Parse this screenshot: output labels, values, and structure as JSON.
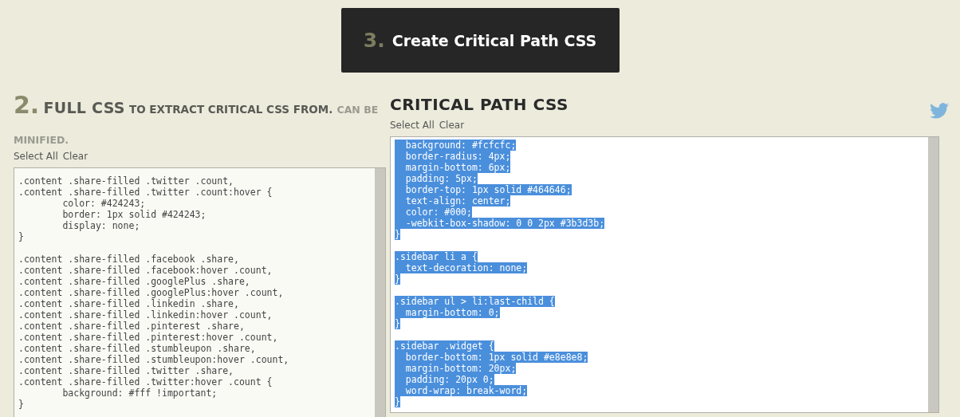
{
  "create_button": {
    "number": "3.",
    "label": "Create Critical Path CSS"
  },
  "full_css": {
    "number": "2.",
    "title": "FULL CSS",
    "subtitle": "TO EXTRACT CRITICAL CSS FROM.",
    "note": "CAN BE MINIFIED.",
    "actions": [
      "Select All",
      "Clear"
    ],
    "blocks": [
      {
        "selected": false,
        "lines": [
          ".content .share-filled .twitter .count,",
          ".content .share-filled .twitter .count:hover {",
          "        color: #424243;",
          "        border: 1px solid #424243;",
          "        display: none;",
          "}"
        ]
      },
      {
        "selected": false,
        "lines": [
          ".content .share-filled .facebook .share,",
          ".content .share-filled .facebook:hover .count,",
          ".content .share-filled .googlePlus .share,",
          ".content .share-filled .googlePlus:hover .count,",
          ".content .share-filled .linkedin .share,",
          ".content .share-filled .linkedin:hover .count,",
          ".content .share-filled .pinterest .share,",
          ".content .share-filled .pinterest:hover .count,",
          ".content .share-filled .stumbleupon .share,",
          ".content .share-filled .stumbleupon:hover .count,",
          ".content .share-filled .twitter .share,",
          ".content .share-filled .twitter:hover .count {",
          "        background: #fff !important;",
          "}"
        ]
      }
    ]
  },
  "critical_css": {
    "title": "CRITICAL PATH CSS",
    "actions": [
      "Select All",
      "Clear"
    ],
    "blocks": [
      {
        "selected": true,
        "lines": [
          "  background: #fcfcfc;",
          "  border-radius: 4px;",
          "  margin-bottom: 6px;",
          "  padding: 5px;",
          "  border-top: 1px solid #464646;",
          "  text-align: center;",
          "  color: #000;",
          "  -webkit-box-shadow: 0 0 2px #3b3d3b;",
          "}"
        ]
      },
      {
        "selected": true,
        "lines": [
          ".sidebar li a {",
          "  text-decoration: none;",
          "}"
        ]
      },
      {
        "selected": true,
        "lines": [
          ".sidebar ul > li:last-child {",
          "  margin-bottom: 0;",
          "}"
        ]
      },
      {
        "selected": true,
        "lines": [
          ".sidebar .widget {",
          "  border-bottom: 1px solid #e8e8e8;",
          "  margin-bottom: 20px;",
          "  padding: 20px 0;",
          "  word-wrap: break-word;",
          "}"
        ]
      }
    ]
  }
}
